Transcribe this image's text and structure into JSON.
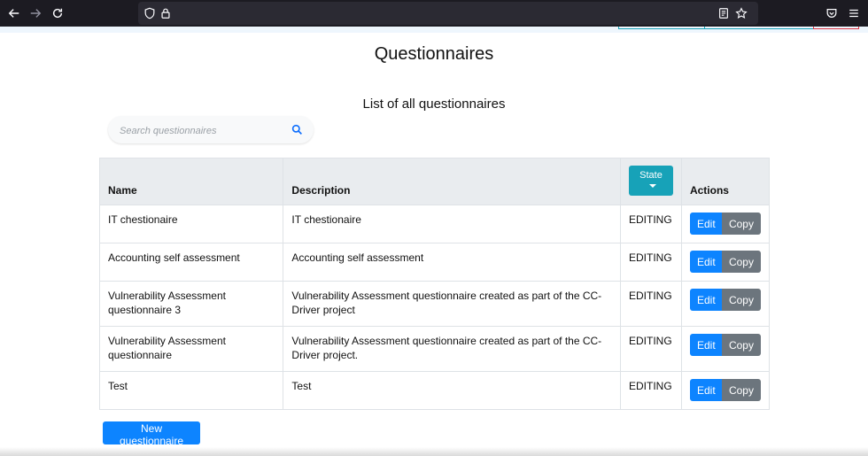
{
  "browser": {
    "back_icon": "arrow-left-icon",
    "forward_icon": "arrow-right-icon",
    "reload_icon": "reload-icon",
    "shield_icon": "shield-icon",
    "lock_icon": "lock-icon",
    "reader_icon": "reader-view-icon",
    "bookmark_icon": "star-icon",
    "pocket_icon": "pocket-icon",
    "menu_icon": "hamburger-menu-icon"
  },
  "page": {
    "title": "Questionnaires",
    "list_title": "List of all questionnaires"
  },
  "search": {
    "placeholder": "Search questionnaires",
    "icon": "search-icon"
  },
  "table": {
    "headers": {
      "name": "Name",
      "description": "Description",
      "state": "State",
      "actions": "Actions"
    },
    "rows": [
      {
        "name": "IT chestionaire",
        "description": "IT chestionaire",
        "state": "EDITING"
      },
      {
        "name": "Accounting self assessment",
        "description": "Accounting self assessment",
        "state": "EDITING"
      },
      {
        "name": "Vulnerability Assessment questionnaire 3",
        "description": "Vulnerability Assessment questionnaire created as part of the CC-Driver project",
        "state": "EDITING"
      },
      {
        "name": "Vulnerability Assessment questionnaire",
        "description": "Vulnerability Assessment questionnaire created as part of the CC-Driver project.",
        "state": "EDITING"
      },
      {
        "name": "Test",
        "description": "Test",
        "state": "EDITING"
      }
    ],
    "edit_label": "Edit",
    "copy_label": "Copy"
  },
  "new_button": "New questionnaire",
  "colors": {
    "primary": "#0d84ff",
    "secondary": "#6c757d",
    "info": "#17a2b8",
    "header_bg": "#e9ecef"
  }
}
